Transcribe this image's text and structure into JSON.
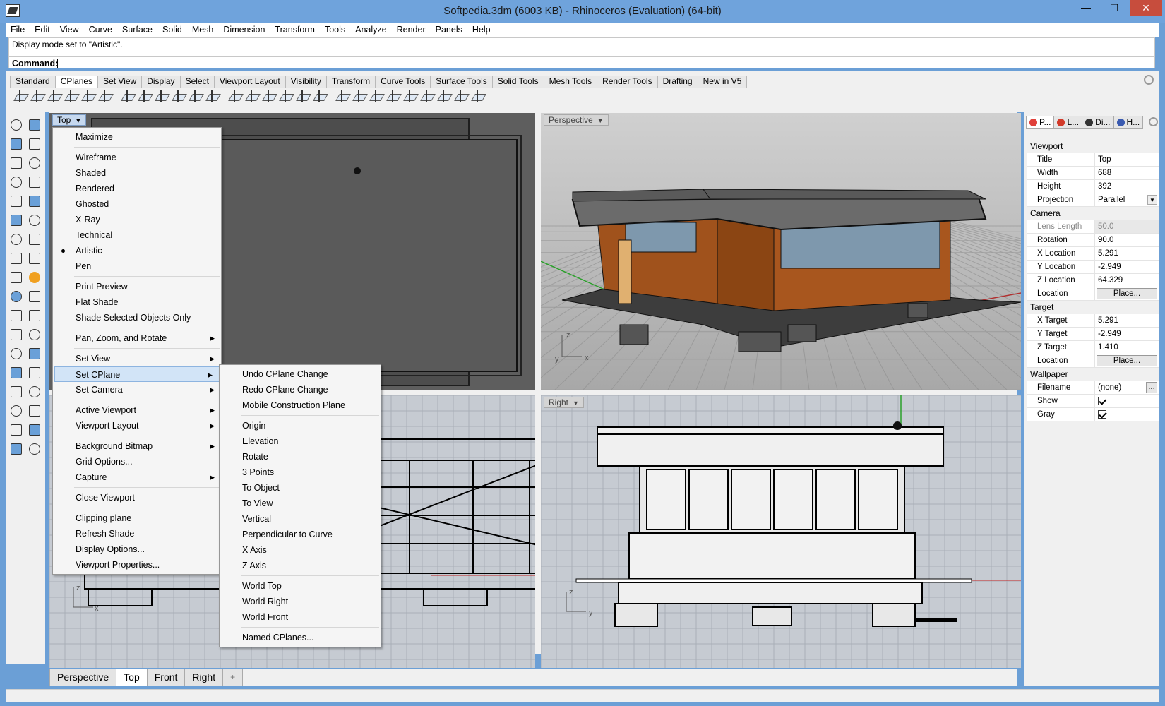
{
  "window": {
    "title": "Softpedia.3dm (6003 KB) - Rhinoceros (Evaluation) (64-bit)",
    "minimize": "—",
    "maximize": "☐",
    "close": "✕"
  },
  "menubar": [
    "File",
    "Edit",
    "View",
    "Curve",
    "Surface",
    "Solid",
    "Mesh",
    "Dimension",
    "Transform",
    "Tools",
    "Analyze",
    "Render",
    "Panels",
    "Help"
  ],
  "command": {
    "history": "Display mode set to \"Artistic\".",
    "prompt": "Command:"
  },
  "toolbar_tabs": [
    "Standard",
    "CPlanes",
    "Set View",
    "Display",
    "Select",
    "Viewport Layout",
    "Visibility",
    "Transform",
    "Curve Tools",
    "Surface Tools",
    "Solid Tools",
    "Mesh Tools",
    "Render Tools",
    "Drafting",
    "New in V5"
  ],
  "toolbar_tabs_active": "CPlanes",
  "viewports": {
    "top": "Top",
    "perspective": "Perspective",
    "front": "Front",
    "right": "Right"
  },
  "viewport_tabs": [
    "Perspective",
    "Top",
    "Front",
    "Right",
    "+"
  ],
  "viewport_tabs_active": "Top",
  "context_menu": {
    "items": [
      {
        "label": "Maximize"
      },
      {
        "sep": true
      },
      {
        "label": "Wireframe"
      },
      {
        "label": "Shaded"
      },
      {
        "label": "Rendered"
      },
      {
        "label": "Ghosted"
      },
      {
        "label": "X-Ray"
      },
      {
        "label": "Technical"
      },
      {
        "label": "Artistic",
        "checked": true
      },
      {
        "label": "Pen"
      },
      {
        "sep": true
      },
      {
        "label": "Print Preview"
      },
      {
        "label": "Flat Shade"
      },
      {
        "label": "Shade Selected Objects Only"
      },
      {
        "sep": true
      },
      {
        "label": "Pan, Zoom, and Rotate",
        "submenu": true
      },
      {
        "sep": true
      },
      {
        "label": "Set View",
        "submenu": true
      },
      {
        "label": "Set CPlane",
        "submenu": true,
        "highlighted": true
      },
      {
        "label": "Set Camera",
        "submenu": true
      },
      {
        "sep": true
      },
      {
        "label": "Active Viewport",
        "submenu": true
      },
      {
        "label": "Viewport Layout",
        "submenu": true
      },
      {
        "sep": true
      },
      {
        "label": "Background Bitmap",
        "submenu": true
      },
      {
        "label": "Grid Options..."
      },
      {
        "label": "Capture",
        "submenu": true
      },
      {
        "sep": true
      },
      {
        "label": "Close Viewport"
      },
      {
        "sep": true
      },
      {
        "label": "Clipping plane"
      },
      {
        "label": "Refresh Shade"
      },
      {
        "label": "Display Options..."
      },
      {
        "label": "Viewport Properties..."
      }
    ]
  },
  "cplane_submenu": {
    "items": [
      {
        "label": "Undo CPlane Change"
      },
      {
        "label": "Redo CPlane Change"
      },
      {
        "label": "Mobile Construction Plane"
      },
      {
        "sep": true
      },
      {
        "label": "Origin"
      },
      {
        "label": "Elevation"
      },
      {
        "label": "Rotate"
      },
      {
        "label": "3 Points"
      },
      {
        "label": "To Object"
      },
      {
        "label": "To View"
      },
      {
        "label": "Vertical"
      },
      {
        "label": "Perpendicular to Curve"
      },
      {
        "label": "X Axis"
      },
      {
        "label": "Z Axis"
      },
      {
        "sep": true
      },
      {
        "label": "World Top"
      },
      {
        "label": "World Right"
      },
      {
        "label": "World Front"
      },
      {
        "sep": true
      },
      {
        "label": "Named CPlanes..."
      }
    ]
  },
  "panel_tabs": [
    {
      "label": "P...",
      "icon": "properties-icon",
      "color": "#e0403a"
    },
    {
      "label": "L...",
      "icon": "layers-icon",
      "color": "#d23a2a"
    },
    {
      "label": "Di...",
      "icon": "display-icon",
      "color": "#333333"
    },
    {
      "label": "H...",
      "icon": "help-icon",
      "color": "#3a5ab0"
    }
  ],
  "properties": {
    "viewport_header": "Viewport",
    "title_k": "Title",
    "title_v": "Top",
    "width_k": "Width",
    "width_v": "688",
    "height_k": "Height",
    "height_v": "392",
    "projection_k": "Projection",
    "projection_v": "Parallel",
    "camera_header": "Camera",
    "lens_k": "Lens Length",
    "lens_v": "50.0",
    "rotation_k": "Rotation",
    "rotation_v": "90.0",
    "xloc_k": "X Location",
    "xloc_v": "5.291",
    "yloc_k": "Y Location",
    "yloc_v": "-2.949",
    "zloc_k": "Z Location",
    "zloc_v": "64.329",
    "loc_k": "Location",
    "place_btn": "Place...",
    "target_header": "Target",
    "xt_k": "X Target",
    "xt_v": "5.291",
    "yt_k": "Y Target",
    "yt_v": "-2.949",
    "zt_k": "Z Target",
    "zt_v": "1.410",
    "tloc_k": "Location",
    "wallpaper_header": "Wallpaper",
    "file_k": "Filename",
    "file_v": "(none)",
    "browse_btn": "...",
    "show_k": "Show",
    "show_v": true,
    "gray_k": "Gray",
    "gray_v": true
  },
  "axes": {
    "x": "x",
    "y": "y",
    "z": "z"
  },
  "colors": {
    "titlebar": "#6fa3dc",
    "highlight": "#d2e4f7",
    "close": "#c74d3d"
  }
}
